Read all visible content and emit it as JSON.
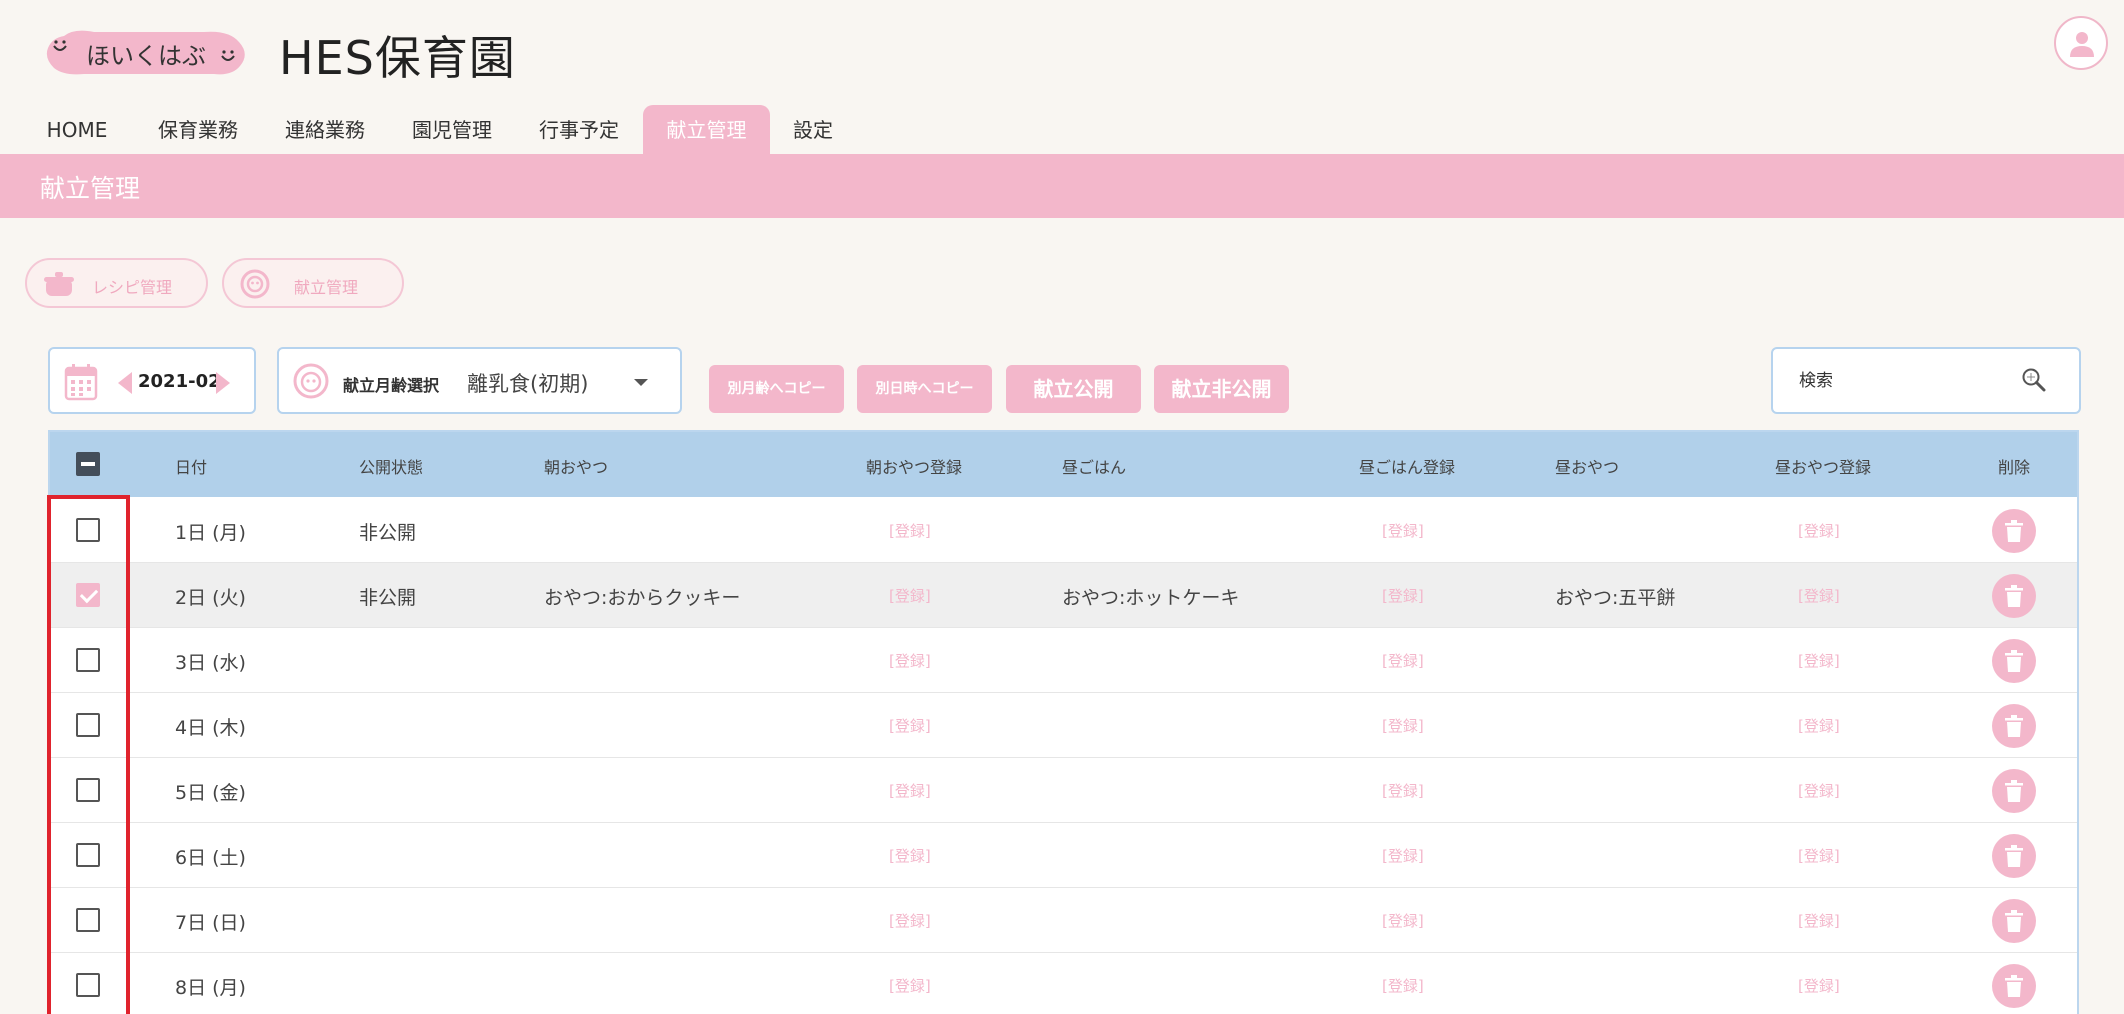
{
  "header": {
    "logo_text": "ほいくはぶ",
    "app_title": "HES保育園",
    "user_icon": "user-icon"
  },
  "nav": {
    "items": [
      {
        "label": "HOME"
      },
      {
        "label": "保育業務"
      },
      {
        "label": "連絡業務"
      },
      {
        "label": "園児管理"
      },
      {
        "label": "行事予定"
      },
      {
        "label": "献立管理",
        "active": true
      },
      {
        "label": "設定"
      }
    ]
  },
  "page_title": "献立管理",
  "sub_tabs": [
    {
      "label": "レシピ管理",
      "icon": "pot-icon"
    },
    {
      "label": "献立管理",
      "icon": "menu-face-icon"
    }
  ],
  "toolbar": {
    "month": "2021-02",
    "age_label": "献立月齢選択",
    "age_value": "離乳食(初期)",
    "copy_age_label": "別月齢へコピー",
    "copy_date_label": "別日時へコピー",
    "publish_label": "献立公開",
    "unpublish_label": "献立非公開",
    "search_placeholder": "検索"
  },
  "table": {
    "columns": [
      "日付",
      "公開状態",
      "朝おやつ",
      "朝おやつ登録",
      "昼ごはん",
      "昼ごはん登録",
      "昼おやつ",
      "昼おやつ登録",
      "削除"
    ],
    "register_label": "[登録]",
    "rows": [
      {
        "date": "1日 (月)",
        "status": "非公開",
        "morning_snack": "",
        "lunch": "",
        "afternoon_snack": "",
        "checked": false
      },
      {
        "date": "2日 (火)",
        "status": "非公開",
        "morning_snack": "おやつ:おからクッキー",
        "lunch": "おやつ:ホットケーキ",
        "afternoon_snack": "おやつ:五平餅",
        "checked": true
      },
      {
        "date": "3日 (水)",
        "status": "",
        "morning_snack": "",
        "lunch": "",
        "afternoon_snack": "",
        "checked": false
      },
      {
        "date": "4日 (木)",
        "status": "",
        "morning_snack": "",
        "lunch": "",
        "afternoon_snack": "",
        "checked": false
      },
      {
        "date": "5日 (金)",
        "status": "",
        "morning_snack": "",
        "lunch": "",
        "afternoon_snack": "",
        "checked": false
      },
      {
        "date": "6日 (土)",
        "status": "",
        "morning_snack": "",
        "lunch": "",
        "afternoon_snack": "",
        "checked": false
      },
      {
        "date": "7日 (日)",
        "status": "",
        "morning_snack": "",
        "lunch": "",
        "afternoon_snack": "",
        "checked": false
      },
      {
        "date": "8日 (月)",
        "status": "",
        "morning_snack": "",
        "lunch": "",
        "afternoon_snack": "",
        "checked": false
      }
    ]
  },
  "colors": {
    "accent_pink": "#f3b7cb",
    "header_blue": "#b1d0ea",
    "border_blue": "#b6d3ee",
    "highlight_red": "#e0232d",
    "background": "#f9f6f2"
  }
}
